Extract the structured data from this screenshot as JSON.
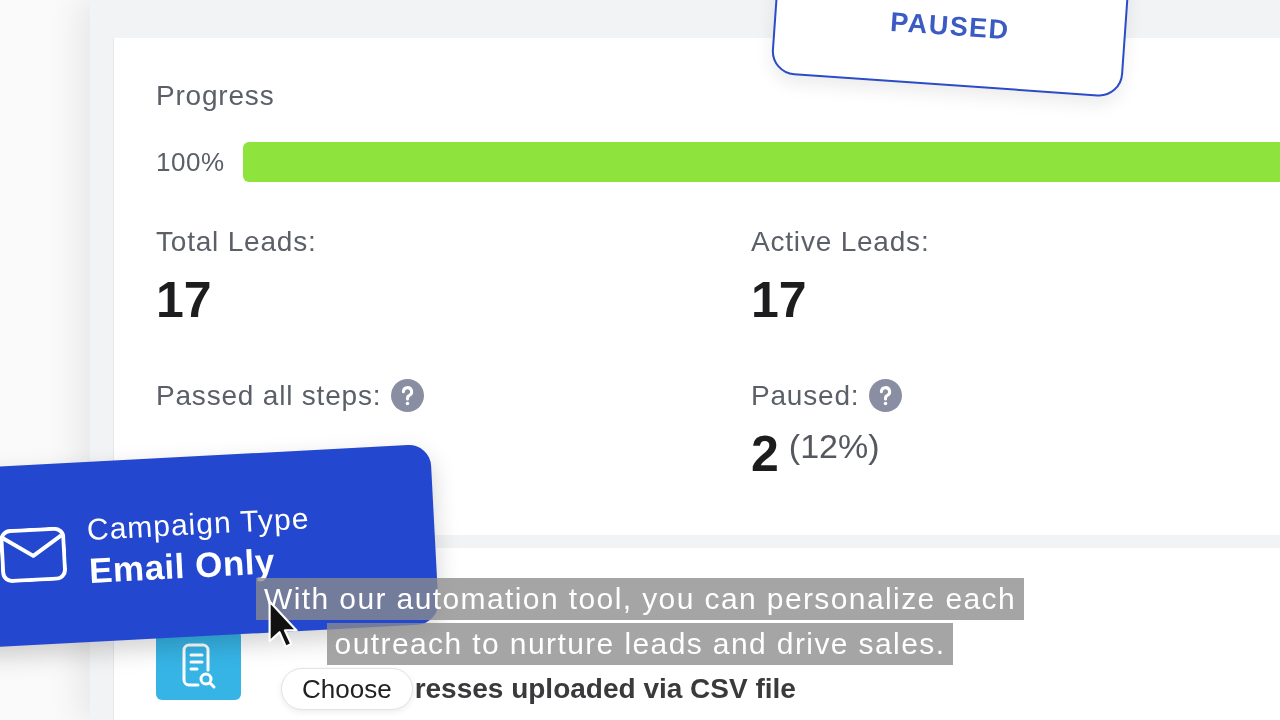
{
  "status_badge": {
    "label": "PAUSED"
  },
  "progress": {
    "label": "Progress",
    "reading": "100%",
    "level": 1
  },
  "stats": [
    {
      "label": "Total Leads:",
      "help": false,
      "value": "17"
    },
    {
      "label": "Active Leads:",
      "help": false,
      "value": "17"
    },
    {
      "label": "Passed all steps:",
      "help": true
    },
    {
      "label": "Paused:",
      "help": true,
      "value": "2",
      "share": "(12%)"
    }
  ],
  "campaign_type": {
    "label": "Campaign Type",
    "value": "Email Only"
  },
  "lead_source": {
    "button": "Choose",
    "value": "resses uploaded via CSV file"
  },
  "caption": {
    "lines": [
      "With our automation tool, you can personalize each",
      "outreach to nurture leads and drive sales."
    ]
  }
}
